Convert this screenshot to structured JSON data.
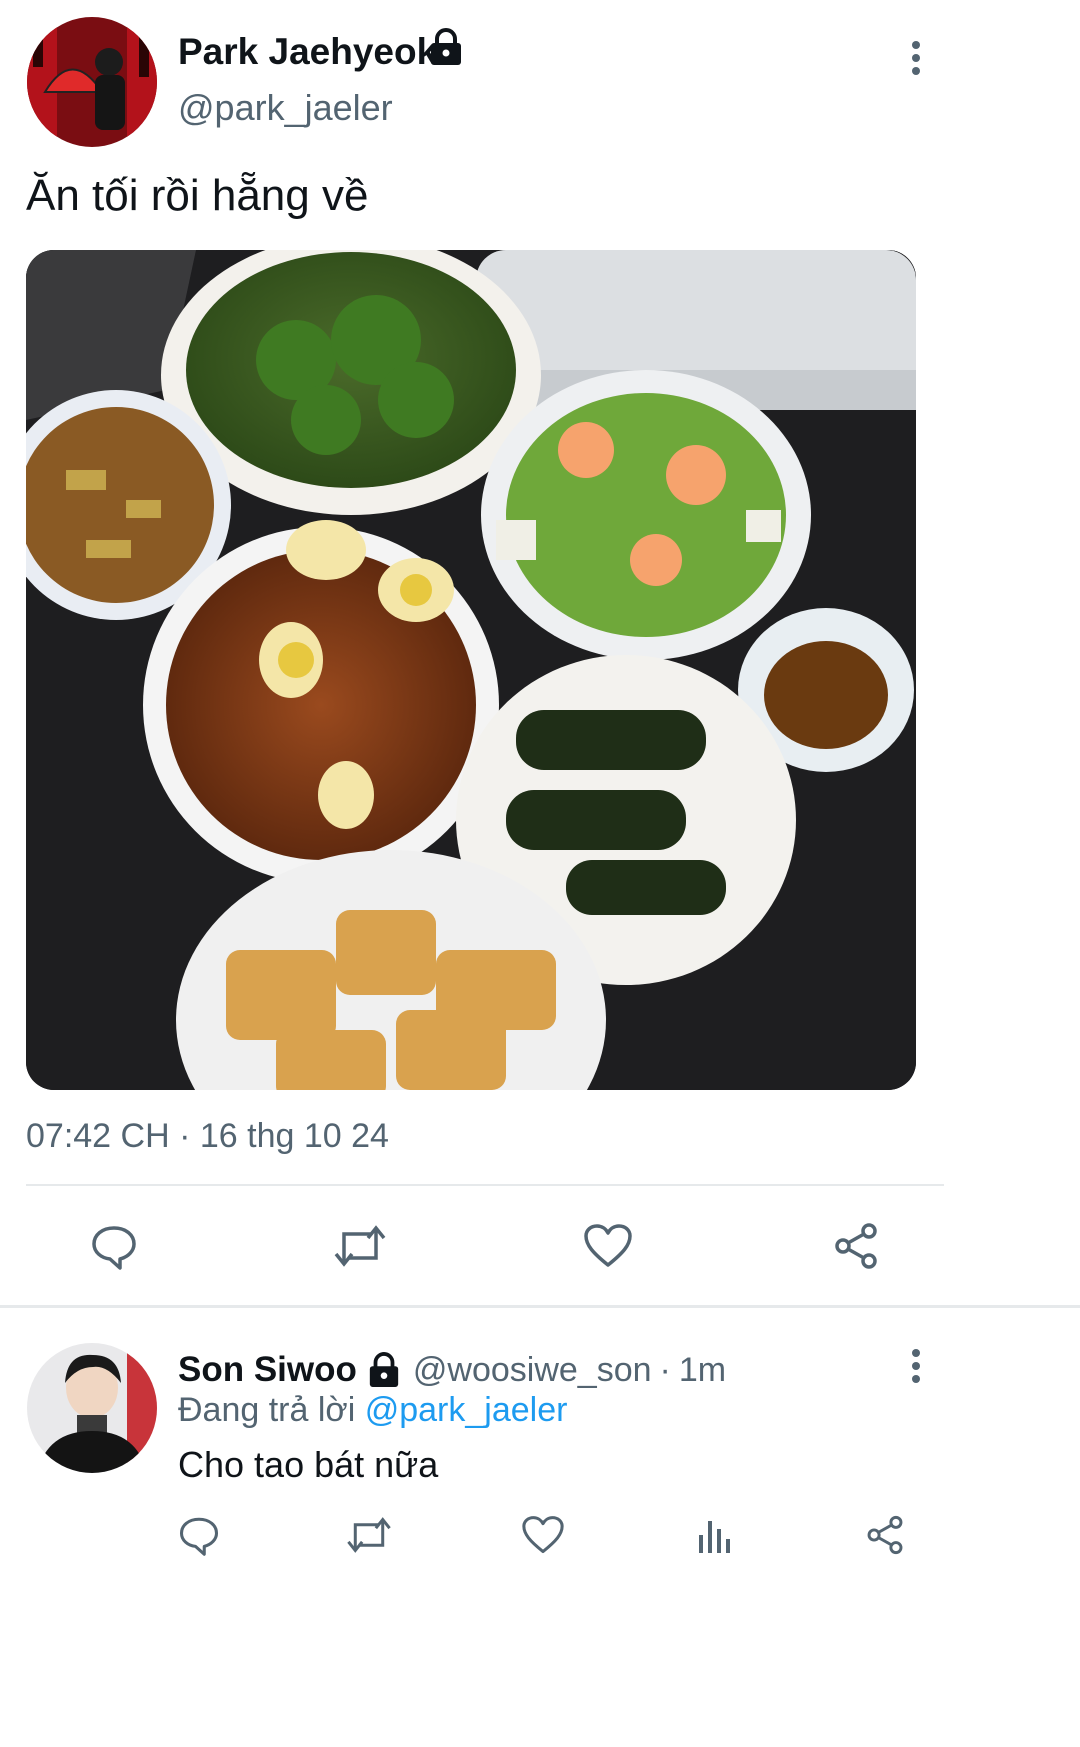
{
  "tweet": {
    "author_name": "Park Jaehyeok",
    "author_handle": "@park_jaeler",
    "locked_icon": "lock-icon",
    "more_icon": "more-vertical-icon",
    "text": "Ăn tối rồi hẵng về",
    "image_icon": "photo-of-dinner-dishes",
    "timestamp": "07:42 CH",
    "dot": "·",
    "date": "16 thg 10 24",
    "actions": [
      "reply-icon",
      "retweet-icon",
      "like-icon",
      "share-icon"
    ]
  },
  "reply": {
    "author_name": "Son Siwoo",
    "author_handle": "@woosiwe_son",
    "dot": "·",
    "time": "1m",
    "replying_prefix": "Đang trả lời",
    "replying_to": "@park_jaeler",
    "text": "Cho tao bát nữa",
    "actions": [
      "reply-icon",
      "retweet-icon",
      "like-icon",
      "views-icon",
      "share-icon"
    ]
  },
  "colors": {
    "text": "#0f1419",
    "muted": "#536471",
    "link": "#1d9bf0",
    "divider": "#e6e9eb"
  }
}
